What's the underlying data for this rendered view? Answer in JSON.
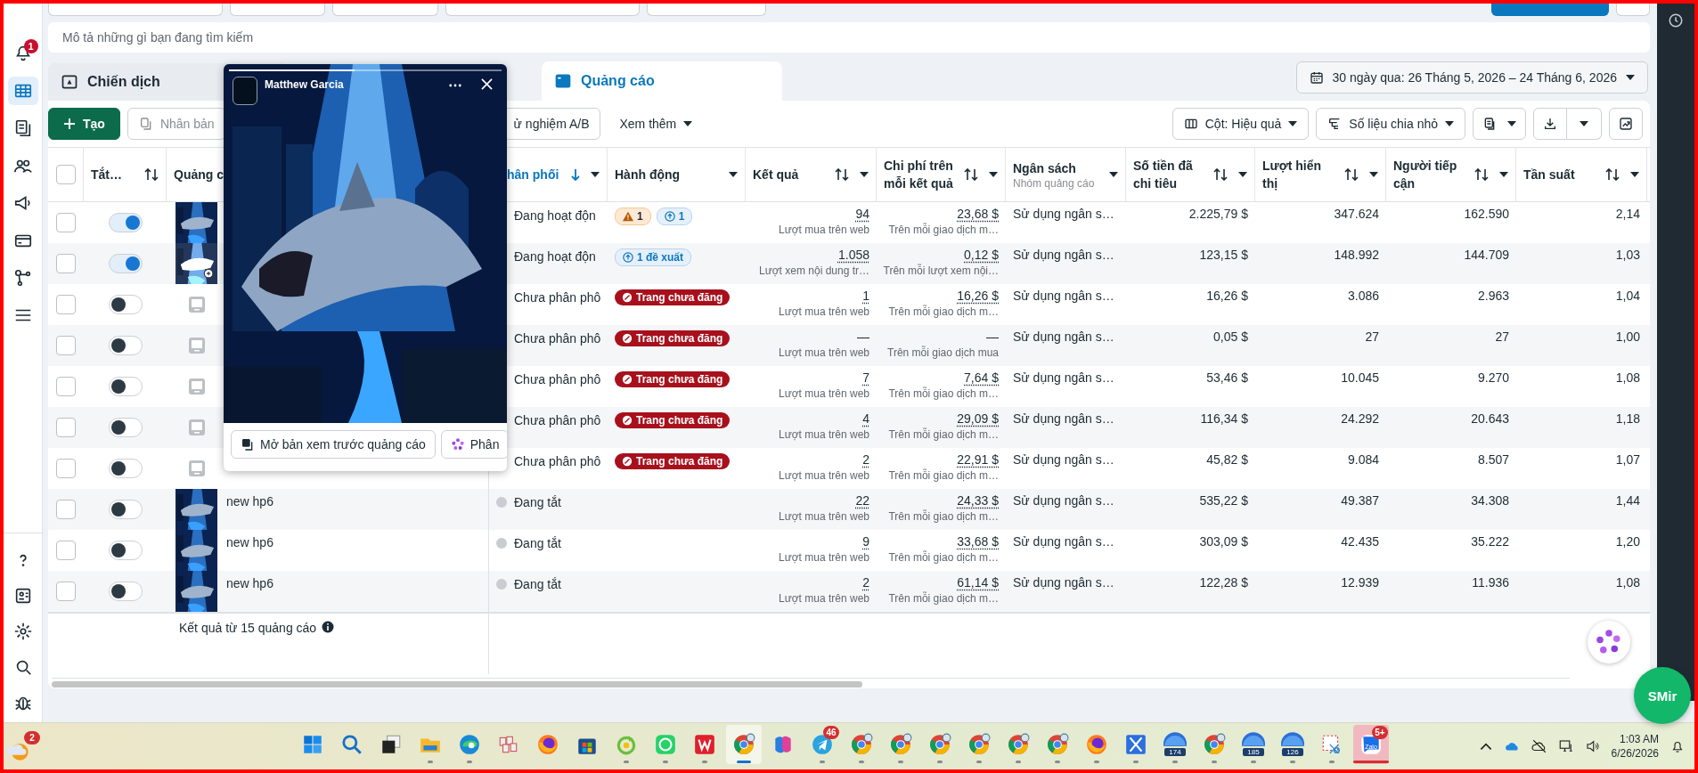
{
  "sidebar": {
    "items": [
      {
        "kind": "alerts",
        "badge": "1",
        "selected": false
      },
      {
        "kind": "table",
        "selected": true
      },
      {
        "kind": "pages",
        "selected": false
      },
      {
        "kind": "people",
        "selected": false
      },
      {
        "kind": "megaphone",
        "selected": false
      },
      {
        "kind": "card",
        "selected": false
      },
      {
        "kind": "network",
        "selected": false
      },
      {
        "kind": "menu",
        "selected": false
      }
    ],
    "bottom_items": [
      {
        "kind": "help",
        "selected": false
      },
      {
        "kind": "contact",
        "selected": false
      },
      {
        "kind": "gear",
        "selected": false
      },
      {
        "kind": "search",
        "selected": false
      },
      {
        "kind": "bug",
        "selected": false
      }
    ]
  },
  "search": {
    "placeholder": "Mô tả những gì bạn đang tìm kiếm"
  },
  "tabs": [
    {
      "label": "Chiến dịch",
      "kind": "campaign",
      "selected": false
    },
    {
      "label": "Quảng cáo",
      "kind": "ad",
      "selected": true
    }
  ],
  "date_range": "30 ngày qua: 26 Tháng 5, 2026 – 24 Tháng 6, 2026",
  "toolbar": {
    "create": "Tạo",
    "duplicate": "Nhân bản",
    "ab_test": "ử nghiệm A/B",
    "more": "Xem thêm",
    "columns": "Cột: Hiệu quả",
    "breakdown": "Số liệu chia nhỏ"
  },
  "table": {
    "all_checked": false,
    "columns": [
      {
        "label": "Tắt…",
        "sortable": true,
        "sorted": false,
        "menu": false
      },
      {
        "label": "Quảng c",
        "sortable": false,
        "sorted": false,
        "menu": false
      },
      {
        "label": "hân phối",
        "sortable": true,
        "sorted": true,
        "menu": true
      },
      {
        "label": "Hành động",
        "sortable": false,
        "sorted": false,
        "menu": true
      },
      {
        "label": "Kết quả",
        "sortable": true,
        "sorted": false,
        "menu": true
      },
      {
        "label": "Chi phí trên mỗi kết quả",
        "sortable": true,
        "sorted": false,
        "menu": true
      },
      {
        "label": "Ngân sách",
        "sub": "Nhóm quảng cáo",
        "sortable": false,
        "sorted": false,
        "menu": true
      },
      {
        "label": "Số tiền đã chi tiêu",
        "sortable": true,
        "sorted": false,
        "menu": true
      },
      {
        "label": "Lượt hiển thị",
        "sortable": true,
        "sorted": false,
        "menu": true
      },
      {
        "label": "Người tiếp cận",
        "sortable": true,
        "sorted": false,
        "menu": true
      },
      {
        "label": "Tần suất",
        "sortable": true,
        "sorted": false,
        "menu": true
      }
    ],
    "rows": [
      {
        "checked": false,
        "on": true,
        "thumbnail": {
          "kind": "picture"
        },
        "status": "Đang hoạt độn",
        "actions": [
          {
            "kind": "warning",
            "text": "1"
          },
          {
            "kind": "suggestion",
            "text": "1"
          }
        ],
        "result": "94",
        "result_label": "Lượt mua trên web",
        "cost": "23,68 $",
        "cost_label": "Trên mỗi giao dịch m…",
        "budget": "Sử dụng ngân s…",
        "spent": "2.225,79 $",
        "impressions": "347.624",
        "reach": "162.590",
        "frequency": "2,14"
      },
      {
        "checked": false,
        "on": true,
        "thumbnail": {
          "kind": "picture"
        },
        "zoom": true,
        "status": "Đang hoạt độn",
        "actions": [
          {
            "kind": "suggestion",
            "text": "1 đề xuất"
          }
        ],
        "result": "1.058",
        "result_label": "Lượt xem nội dung tr…",
        "cost": "0,12 $",
        "cost_label": "Trên mỗi lượt xem nội…",
        "budget": "Sử dụng ngân s…",
        "spent": "123,15 $",
        "impressions": "148.992",
        "reach": "144.709",
        "frequency": "1,03"
      },
      {
        "checked": false,
        "on": false,
        "thumbnail": {
          "kind": "placeholder"
        },
        "status": "Chưa phân phô",
        "actions": [
          {
            "kind": "error",
            "text": "Trang chưa đăng"
          }
        ],
        "result": "1",
        "result_label": "Lượt mua trên web",
        "cost": "16,26 $",
        "cost_label": "Trên mỗi giao dịch m…",
        "budget": "Sử dụng ngân s…",
        "spent": "16,26 $",
        "impressions": "3.086",
        "reach": "2.963",
        "frequency": "1,04"
      },
      {
        "checked": false,
        "on": false,
        "thumbnail": {
          "kind": "placeholder"
        },
        "status": "Chưa phân phô",
        "actions": [
          {
            "kind": "error",
            "text": "Trang chưa đăng"
          }
        ],
        "result": "—",
        "result_label": "Lượt mua trên web",
        "cost": "—",
        "cost_label": "Trên mỗi giao dịch mua",
        "budget": "Sử dụng ngân s…",
        "spent": "0,05 $",
        "impressions": "27",
        "reach": "27",
        "frequency": "1,00"
      },
      {
        "checked": false,
        "on": false,
        "thumbnail": {
          "kind": "placeholder"
        },
        "status": "Chưa phân phô",
        "actions": [
          {
            "kind": "error",
            "text": "Trang chưa đăng"
          }
        ],
        "result": "7",
        "result_label": "Lượt mua trên web",
        "cost": "7,64 $",
        "cost_label": "Trên mỗi giao dịch m…",
        "budget": "Sử dụng ngân s…",
        "spent": "53,46 $",
        "impressions": "10.045",
        "reach": "9.270",
        "frequency": "1,08"
      },
      {
        "checked": false,
        "on": false,
        "thumbnail": {
          "kind": "placeholder"
        },
        "status": "Chưa phân phô",
        "actions": [
          {
            "kind": "error",
            "text": "Trang chưa đăng"
          }
        ],
        "result": "4",
        "result_label": "Lượt mua trên web",
        "cost": "29,09 $",
        "cost_label": "Trên mỗi giao dịch m…",
        "budget": "Sử dụng ngân s…",
        "spent": "116,34 $",
        "impressions": "24.292",
        "reach": "20.643",
        "frequency": "1,18"
      },
      {
        "checked": false,
        "on": false,
        "thumbnail": {
          "kind": "placeholder"
        },
        "status": "Chưa phân phô",
        "actions": [
          {
            "kind": "error",
            "text": "Trang chưa đăng"
          }
        ],
        "result": "2",
        "result_label": "Lượt mua trên web",
        "cost": "22,91 $",
        "cost_label": "Trên mỗi giao dịch m…",
        "budget": "Sử dụng ngân s…",
        "spent": "45,82 $",
        "impressions": "9.084",
        "reach": "8.507",
        "frequency": "1,07"
      },
      {
        "checked": false,
        "on": false,
        "thumbnail": {
          "kind": "picture"
        },
        "name": "new hp6",
        "color": "#c9ccd1",
        "status": "Đang tắt",
        "actions": [],
        "result": "22",
        "result_label": "Lượt mua trên web",
        "cost": "24,33 $",
        "cost_label": "Trên mỗi giao dịch m…",
        "budget": "Sử dụng ngân s…",
        "spent": "535,22 $",
        "impressions": "49.387",
        "reach": "34.308",
        "frequency": "1,44"
      },
      {
        "checked": false,
        "on": false,
        "thumbnail": {
          "kind": "picture"
        },
        "name": "new hp6",
        "color": "#c9ccd1",
        "status": "Đang tắt",
        "actions": [],
        "result": "9",
        "result_label": "Lượt mua trên web",
        "cost": "33,68 $",
        "cost_label": "Trên mỗi giao dịch m…",
        "budget": "Sử dụng ngân s…",
        "spent": "303,09 $",
        "impressions": "42.435",
        "reach": "35.222",
        "frequency": "1,20"
      },
      {
        "checked": false,
        "on": false,
        "thumbnail": {
          "kind": "picture"
        },
        "name": "new hp6",
        "color": "#c9ccd1",
        "status": "Đang tắt",
        "actions": [],
        "result": "2",
        "result_label": "Lượt mua trên web",
        "cost": "61,14 $",
        "cost_label": "Trên mỗi giao dịch m…",
        "budget": "Sử dụng ngân s…",
        "spent": "122,28 $",
        "impressions": "12.939",
        "reach": "11.936",
        "frequency": "1,08"
      }
    ],
    "footer": "Kết quả từ 15 quảng cáo"
  },
  "preview": {
    "name": "Matthew Garcia",
    "level": 0.46,
    "buttons": [
      {
        "kind": "preview",
        "label": "Mở bản xem trước quảng cáo"
      },
      {
        "kind": "ai",
        "label": "Phân"
      }
    ]
  },
  "assistant": {
    "label": "SMir"
  },
  "taskbar": {
    "weather_badge": "2",
    "apps": [
      {
        "kind": "windows",
        "running": false,
        "active": false
      },
      {
        "kind": "search",
        "running": false,
        "active": false
      },
      {
        "kind": "taskview",
        "running": false,
        "active": false
      },
      {
        "kind": "folder",
        "running": true,
        "active": false
      },
      {
        "kind": "edge",
        "running": true,
        "active": false
      },
      {
        "kind": "tiles",
        "running": false,
        "active": false
      },
      {
        "kind": "firefox",
        "running": false,
        "active": false
      },
      {
        "kind": "store",
        "running": false,
        "active": false
      },
      {
        "kind": "leaf",
        "running": true,
        "active": false
      },
      {
        "kind": "chat",
        "running": true,
        "active": false
      },
      {
        "kind": "wps",
        "running": true,
        "active": false
      },
      {
        "kind": "chrome",
        "running": true,
        "active": true
      },
      {
        "kind": "copilot",
        "running": false,
        "active": false
      },
      {
        "kind": "telegram",
        "badge": "46",
        "running": true,
        "active": false
      },
      {
        "kind": "chrome",
        "running": true,
        "active": false
      },
      {
        "kind": "chrome",
        "running": true,
        "active": false
      },
      {
        "kind": "chrome",
        "running": true,
        "active": false
      },
      {
        "kind": "chrome",
        "running": true,
        "active": false
      },
      {
        "kind": "chrome",
        "running": true,
        "active": false
      },
      {
        "kind": "chrome",
        "running": true,
        "active": false
      },
      {
        "kind": "firefox",
        "running": true,
        "active": false
      },
      {
        "kind": "xapp",
        "running": true,
        "active": false
      },
      {
        "kind": "orbit",
        "label": "174",
        "running": true,
        "active": false
      },
      {
        "kind": "chrome",
        "running": true,
        "active": false
      },
      {
        "kind": "orbit",
        "label": "185",
        "running": true,
        "active": false
      },
      {
        "kind": "orbit",
        "label": "126",
        "running": true,
        "active": false
      },
      {
        "kind": "snip",
        "running": true,
        "active": false
      },
      {
        "kind": "zalo",
        "label": "Zalo",
        "badge": "5+",
        "running": true,
        "active": true
      }
    ],
    "time": "1:03 AM",
    "date": "6/26/2026"
  }
}
